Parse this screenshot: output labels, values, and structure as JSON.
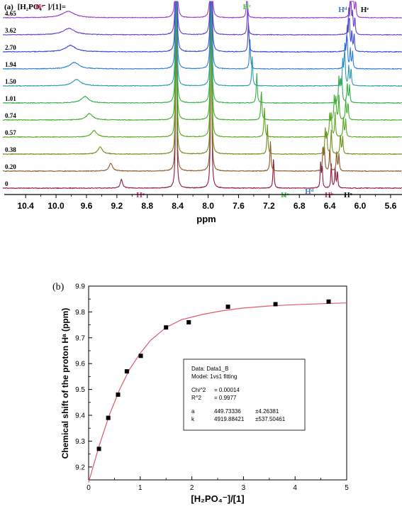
{
  "chart_data": [
    {
      "type": "line",
      "panel_label": "(a)",
      "conc_label": "[H₂PO₄⁻ ]/[1]=",
      "xlabel": "ppm",
      "xlim": [
        10.7,
        5.45
      ],
      "x_ticks": [
        "10.4",
        "10.0",
        "9.6",
        "9.2",
        "8.8",
        "8.4",
        "8.0",
        "7.6",
        "7.2",
        "6.8",
        "6.4",
        "6.0",
        "5.6"
      ],
      "x_tick_values": [
        10.4,
        10.0,
        9.6,
        9.2,
        8.8,
        8.4,
        8.0,
        7.6,
        7.2,
        6.8,
        6.4,
        6.0,
        5.6
      ],
      "fixed_peaks_ppm": [
        8.42,
        7.96
      ],
      "series": [
        {
          "name": "0",
          "color": "#8b1a3a",
          "Ha": 9.14,
          "Hc": 7.14,
          "Hd": 6.52,
          "Hb": 6.38,
          "He": 6.33
        },
        {
          "name": "0.20",
          "color": "#8b5a2b",
          "Ha": 9.28,
          "Hc": 7.18,
          "Hd": 6.49,
          "Hb": 6.4,
          "He": 6.31
        },
        {
          "name": "0.38",
          "color": "#6f8f1f",
          "Ha": 9.42,
          "Hc": 7.22,
          "Hd": 6.46,
          "Hb": 6.38,
          "He": 6.26
        },
        {
          "name": "0.57",
          "color": "#58a81f",
          "Ha": 9.5,
          "Hc": 7.26,
          "Hd": 6.4,
          "Hb": 6.33,
          "He": 6.22
        },
        {
          "name": "0.74",
          "color": "#3fae2a",
          "Ha": 9.56,
          "Hc": 7.3,
          "Hd": 6.34,
          "Hb": 6.28,
          "He": 6.19
        },
        {
          "name": "1.01",
          "color": "#35b04a",
          "Ha": 9.62,
          "Hc": 7.36,
          "Hd": 6.28,
          "Hb": 6.24,
          "He": 6.17
        },
        {
          "name": "1.50",
          "color": "#2e9bb0",
          "Ha": 9.73,
          "Hc": 7.42,
          "Hd": 6.23,
          "Hb": 6.2,
          "He": 6.15
        },
        {
          "name": "1.94",
          "color": "#2c7fd6",
          "Ha": 9.76,
          "Hc": 7.45,
          "Hd": 6.2,
          "Hb": 6.17,
          "He": 6.13
        },
        {
          "name": "2.70",
          "color": "#3b4bd6",
          "Ha": 9.81,
          "Hc": 7.47,
          "Hd": 6.17,
          "Hb": 6.14,
          "He": 6.11
        },
        {
          "name": "3.62",
          "color": "#6a3fd0",
          "Ha": 9.83,
          "Hc": 7.48,
          "Hd": 6.15,
          "Hb": 6.12,
          "He": 6.1
        },
        {
          "name": "4.65",
          "color": "#9b3fc8",
          "Ha": 9.84,
          "Hc": 7.49,
          "Hd": 6.13,
          "Hb": 6.11,
          "He": 6.09
        }
      ],
      "annotations": {
        "top": {
          "Ha": "Hᵃ",
          "Hc": "Hᶜ",
          "Hd": "Hᵈ",
          "He": "Hᵉ"
        },
        "bottom": {
          "Ha": "Hᵃ",
          "Hc": "Hᶜ",
          "Hd": "Hᵈ",
          "Hb": "Hᵇ",
          "He": "Hᵉ"
        },
        "colors": {
          "Ha": "#c0306a",
          "Hc": "#3fc43f",
          "Hd": "#3c78c8",
          "Hb": "#c0306a",
          "He": "#111111"
        }
      }
    },
    {
      "type": "scatter",
      "panel_label": "(b)",
      "xlabel": "[H₂PO₄⁻]/[1]",
      "ylabel": "Chemical shift of the proton Hᵃ (ppm)",
      "xlim": [
        0,
        5
      ],
      "ylim": [
        9.15,
        9.9
      ],
      "x_ticks": [
        "0",
        "1",
        "2",
        "3",
        "4",
        "5"
      ],
      "y_ticks": [
        "9.2",
        "9.3",
        "9.4",
        "9.5",
        "9.6",
        "9.7",
        "9.8",
        "9.9"
      ],
      "points": [
        {
          "x": 0.2,
          "y": 9.27
        },
        {
          "x": 0.38,
          "y": 9.39
        },
        {
          "x": 0.57,
          "y": 9.48
        },
        {
          "x": 0.74,
          "y": 9.57
        },
        {
          "x": 1.01,
          "y": 9.63
        },
        {
          "x": 1.5,
          "y": 9.74
        },
        {
          "x": 1.94,
          "y": 9.76
        },
        {
          "x": 2.7,
          "y": 9.82
        },
        {
          "x": 3.62,
          "y": 9.83
        },
        {
          "x": 4.65,
          "y": 9.84
        }
      ],
      "fit_curve": {
        "color": "#e05a6a",
        "x": [
          0,
          0.2,
          0.4,
          0.6,
          0.8,
          1.0,
          1.2,
          1.5,
          1.8,
          2.2,
          2.6,
          3.0,
          3.5,
          4.0,
          4.5,
          5.0
        ],
        "y": [
          9.14,
          9.28,
          9.4,
          9.5,
          9.58,
          9.64,
          9.69,
          9.74,
          9.77,
          9.79,
          9.805,
          9.815,
          9.823,
          9.828,
          9.832,
          9.835
        ]
      },
      "legend_box": {
        "data": "Data: Data1_B",
        "model": "Model: 1vs1 fitting",
        "chi_label": "Chi^2",
        "chi_value": "= 0.00014",
        "r_label": "R^2",
        "r_value": "= 0.9977",
        "a_label": "a",
        "a_value": "449.73336",
        "a_err": "±4.26381",
        "k_label": "k",
        "k_value": "4919.88421",
        "k_err": "±537.50461"
      }
    }
  ]
}
